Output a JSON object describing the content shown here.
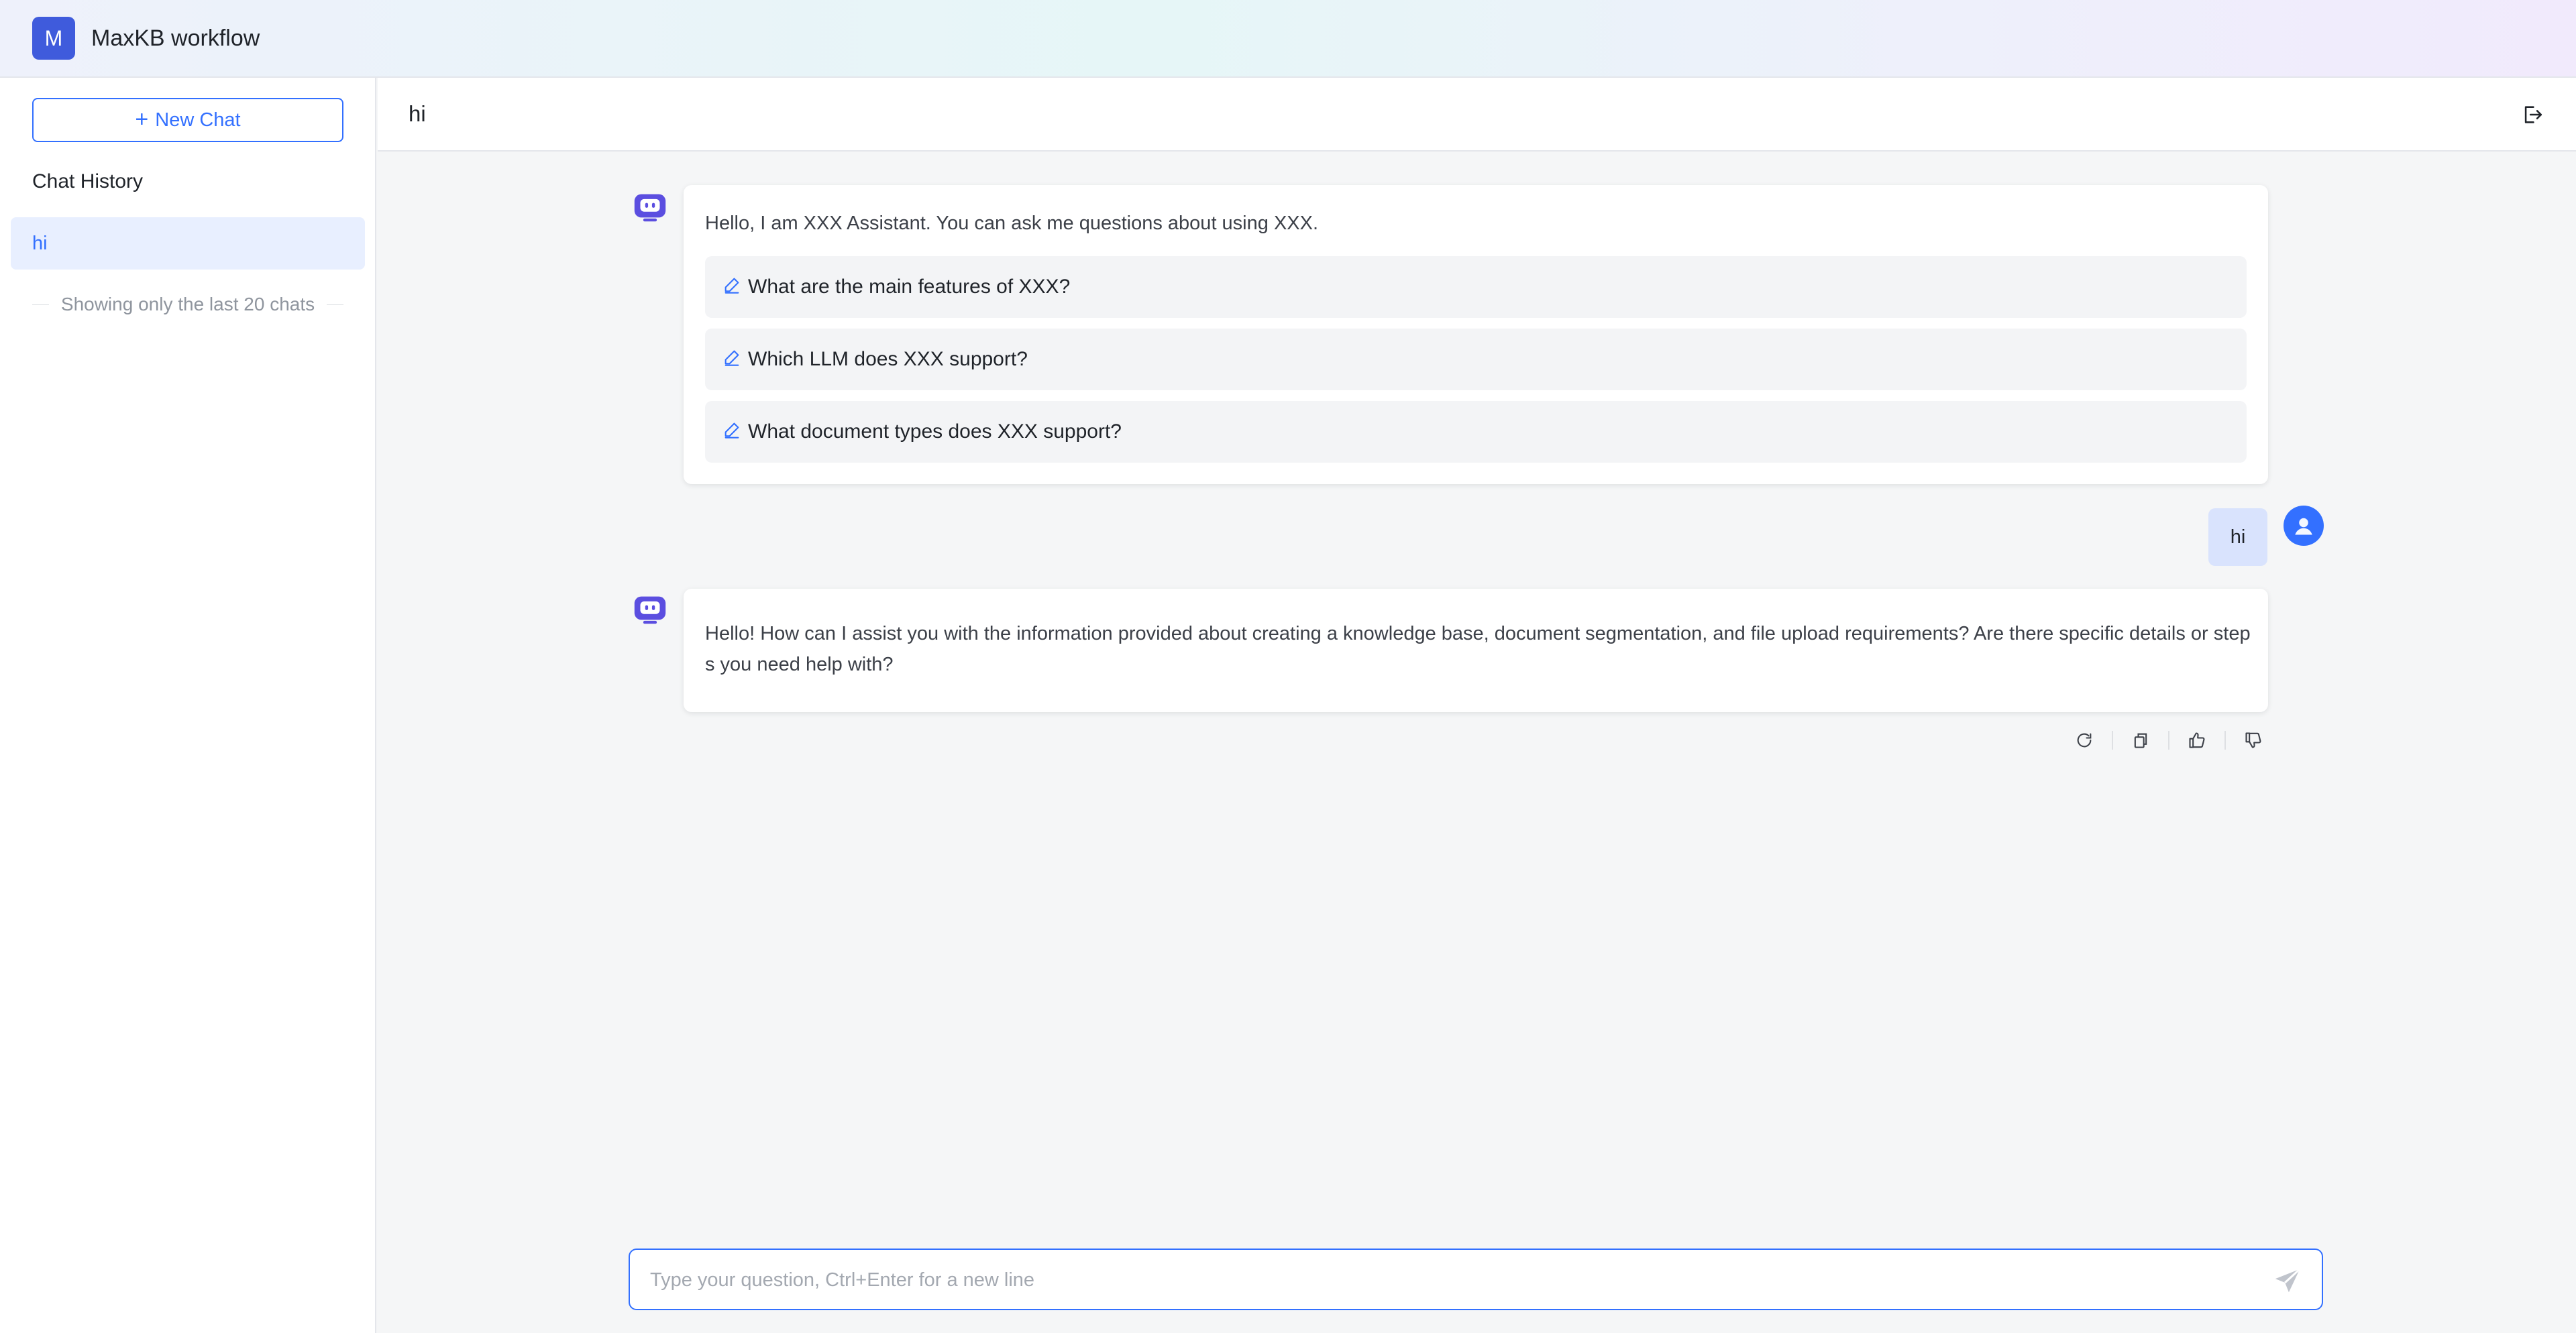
{
  "app": {
    "avatar_letter": "M",
    "title": "MaxKB workflow"
  },
  "sidebar": {
    "new_chat_label": "New Chat",
    "history_title": "Chat History",
    "history_items": [
      {
        "label": "hi"
      }
    ],
    "history_note": "Showing only the last 20 chats"
  },
  "chat": {
    "title": "hi",
    "greeting": "Hello, I am XXX Assistant. You can ask me questions about using XXX.",
    "suggested_prompts": [
      "What are the main features of XXX?",
      "Which LLM does XXX support?",
      "What document types does XXX support?"
    ],
    "user_message": "hi",
    "bot_reply": "Hello! How can I assist you with the information provided about creating a knowledge base, document segmentation, and file upload requirements? Are there specific details or steps you need help with?"
  },
  "input": {
    "placeholder": "Type your question, Ctrl+Enter for a new line",
    "value": ""
  },
  "icons": {
    "logout": "logout-icon",
    "bot": "robot-icon",
    "user": "user-icon",
    "prompt": "pen-icon",
    "actions": [
      "regenerate-icon",
      "copy-icon",
      "thumbs-up-icon",
      "thumbs-down-icon"
    ],
    "send": "send-icon"
  },
  "colors": {
    "accent": "#3370ff",
    "brand_avatar": "#3f5bdc",
    "bot_icon": "#5b4ee0"
  }
}
